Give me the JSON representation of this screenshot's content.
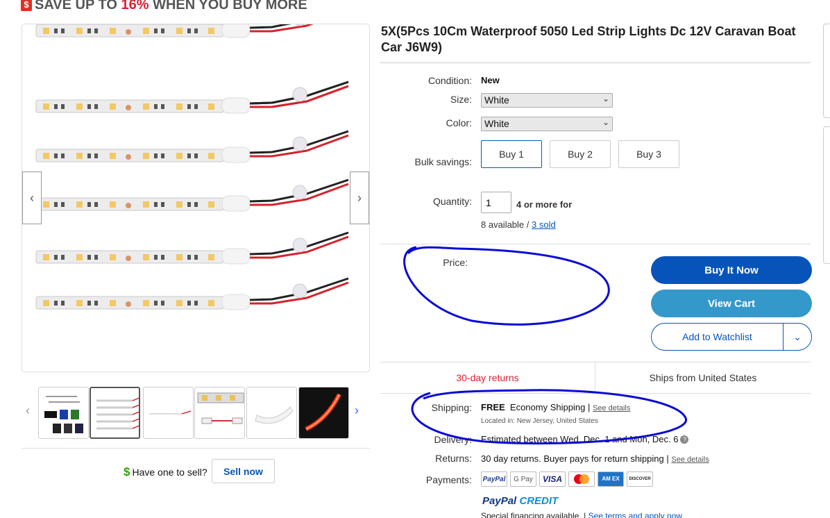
{
  "banner": {
    "prefix": "SAVE UP TO ",
    "percent": "16%",
    "suffix": " WHEN YOU BUY MORE",
    "icon": "dollar-tag-icon",
    "icon_glyph": "$"
  },
  "gallery": {
    "prev_glyph": "‹",
    "next_glyph": "›",
    "main_image": "led-strips-five-white"
  },
  "thumbnails": {
    "prev_glyph": "‹",
    "next_glyph": "›",
    "items": [
      "multicolor-strips",
      "five-white-strips",
      "single-strip",
      "strip-closeup",
      "white-strip-curled",
      "red-lit-strip"
    ]
  },
  "sell": {
    "glyph": "$",
    "prompt": "Have one to sell?",
    "button": "Sell now"
  },
  "product": {
    "title": "5X(5Pcs 10Cm Waterproof 5050 Led Strip Lights Dc 12V Caravan Boat Car J6W9)",
    "condition_label": "Condition:",
    "condition_value": "New",
    "size_label": "Size:",
    "size_value": "White",
    "color_label": "Color:",
    "color_value": "White",
    "bulk_label": "Bulk savings:",
    "bulk_options": [
      "Buy 1",
      "Buy 2",
      "Buy 3"
    ],
    "quantity_label": "Quantity:",
    "quantity_value": "1",
    "quantity_note": "4 or more for",
    "available": "8 available / ",
    "sold": "3 sold",
    "price_label": "Price:"
  },
  "actions": {
    "buy_now": "Buy It Now",
    "view_cart": "View Cart",
    "watchlist": "Add to Watchlist",
    "watch_chevron": "⌄"
  },
  "tabs": {
    "returns": "30-day returns",
    "ships": "Ships from United States"
  },
  "shipping": {
    "label": "Shipping:",
    "free": "FREE",
    "method": "Economy Shipping",
    "sep": "|",
    "details": "See details",
    "location": "Located in:  New Jersey, United States"
  },
  "delivery": {
    "label": "Delivery:",
    "text": "Estimated between Wed, Dec. 1 and Mon, Dec. 6"
  },
  "returns": {
    "label": "Returns:",
    "text": "30 day returns. Buyer pays for return shipping",
    "sep": "|",
    "details": "See details"
  },
  "payments": {
    "label": "Payments:",
    "methods": [
      "PayPal",
      "G Pay",
      "VISA",
      "",
      "AM EX",
      "DISCOVER"
    ],
    "paypal_credit_1": "PayPal",
    "paypal_credit_2": " CREDIT",
    "special": "Special financing available.",
    "terms": "See terms and apply now"
  },
  "colors": {
    "primary_blue": "#0654ba",
    "cart_blue": "#3498ca",
    "red": "#dd1e31",
    "annotation": "#0a0ad4"
  }
}
